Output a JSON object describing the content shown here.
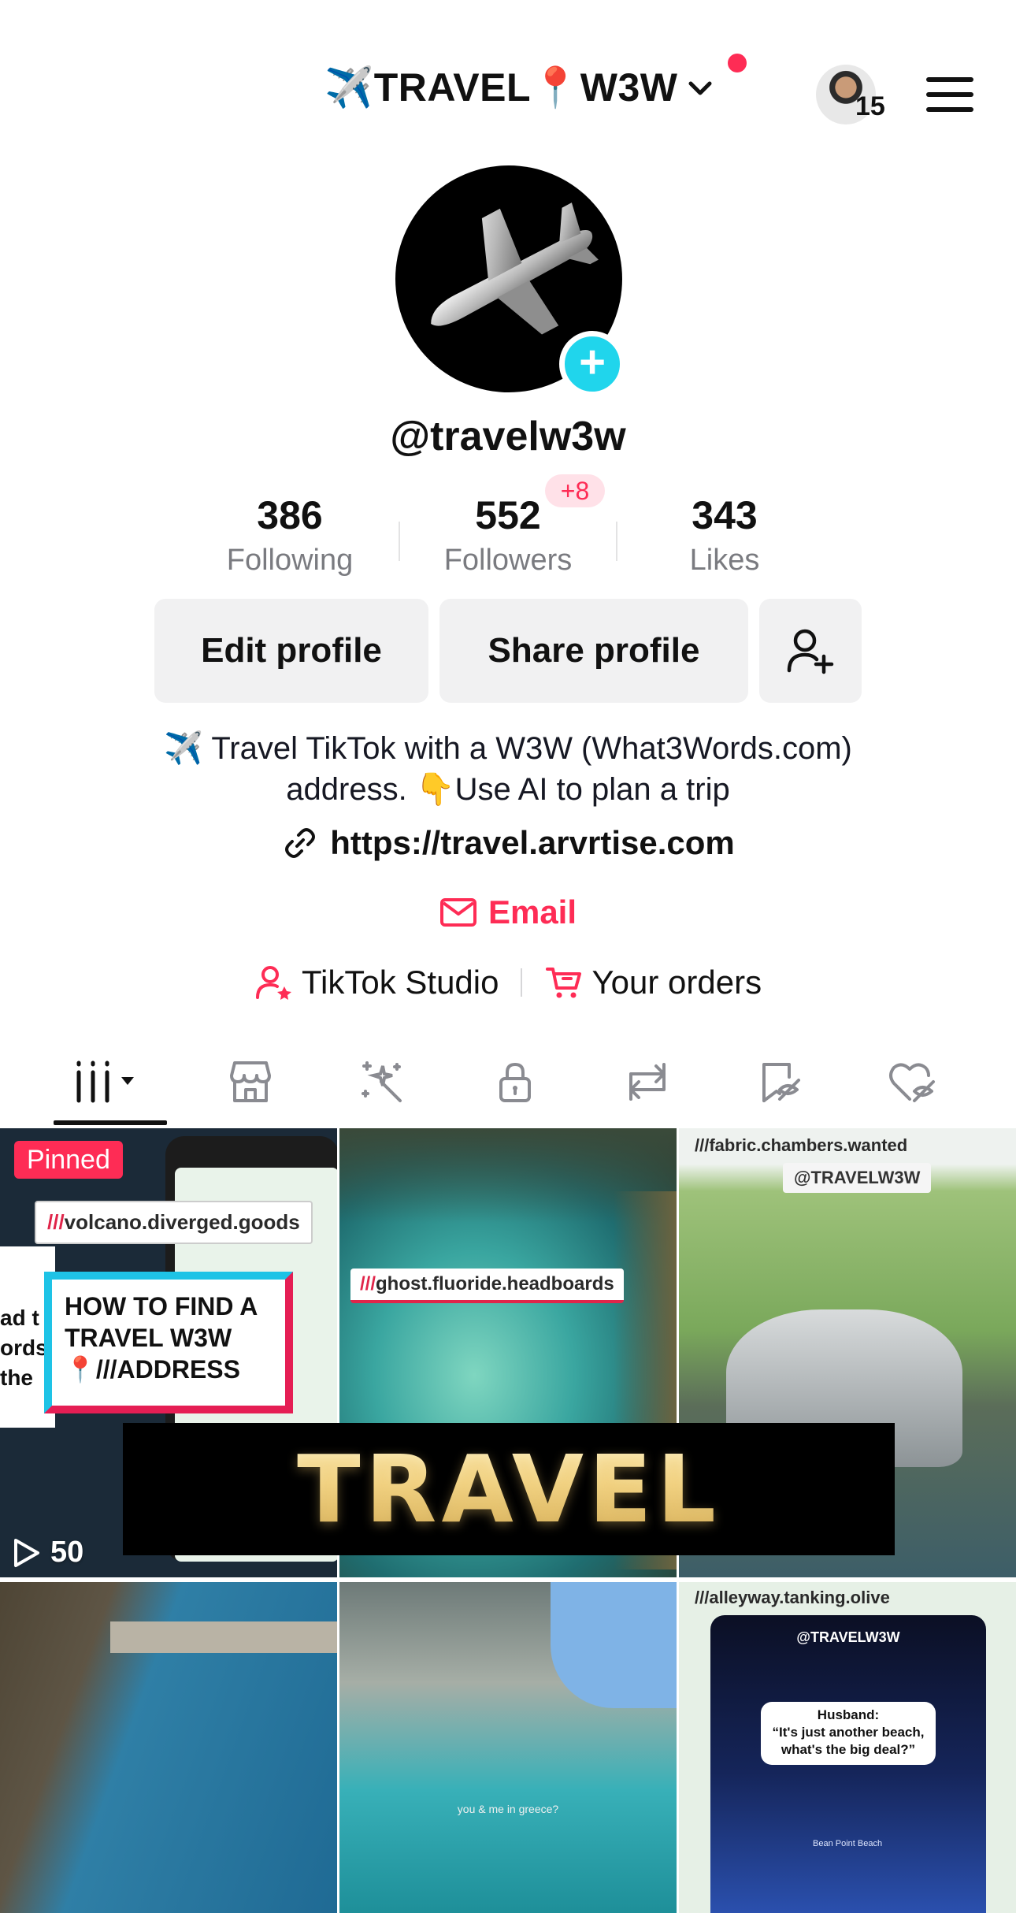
{
  "header": {
    "account_name": "✈️TRAVEL📍W3W",
    "avatar_count": "15"
  },
  "profile": {
    "username": "@travelw3w",
    "stats": {
      "following_count": "386",
      "following_label": "Following",
      "followers_count": "552",
      "followers_label": "Followers",
      "followers_new": "+8",
      "likes_count": "343",
      "likes_label": "Likes"
    },
    "buttons": {
      "edit": "Edit profile",
      "share": "Share profile"
    },
    "bio_line1": "✈️ Travel TikTok with a W3W (What3Words.com)",
    "bio_line2": "address. 👇Use AI to plan a trip",
    "link": "https://travel.arvrtise.com",
    "email": "Email",
    "studio": "TikTok Studio",
    "orders": "Your orders"
  },
  "tabs": [
    "videos-tab",
    "shop-tab",
    "creations-tab",
    "private-tab",
    "reposts-tab",
    "favorites-tab",
    "liked-tab"
  ],
  "grid": {
    "items": [
      {
        "pinned": "Pinned",
        "views": "50",
        "tag": "volcano.diverged.goods",
        "title_line1": "HOW TO FIND A",
        "title_line2": "TRAVEL W3W",
        "title_line3": "📍///ADDRESS",
        "side_text_1": "ad t",
        "side_text_2": "ords",
        "side_text_3": "the"
      },
      {
        "tag": "ghost.fluoride.headboards"
      },
      {
        "tag": "fabric.chambers.wanted",
        "handle": "@TRAVELW3W"
      },
      {},
      {
        "caption": "you & me in greece?"
      },
      {
        "tag": "alleyway.tanking.olive",
        "handle": "@TRAVELW3W",
        "bubble_line1": "Husband:",
        "bubble_line2": "“It's just another beach,",
        "bubble_line3": "what's the big deal?”",
        "pin_label": "Bean Point Beach"
      }
    ],
    "slash": "///"
  },
  "overlay": {
    "banner_text": "TRAVEL"
  },
  "colors": {
    "accent": "#fe2c55",
    "badge_cyan": "#20d5ec",
    "button_bg": "#f1f1f2",
    "muted_text": "#7a7b80"
  }
}
